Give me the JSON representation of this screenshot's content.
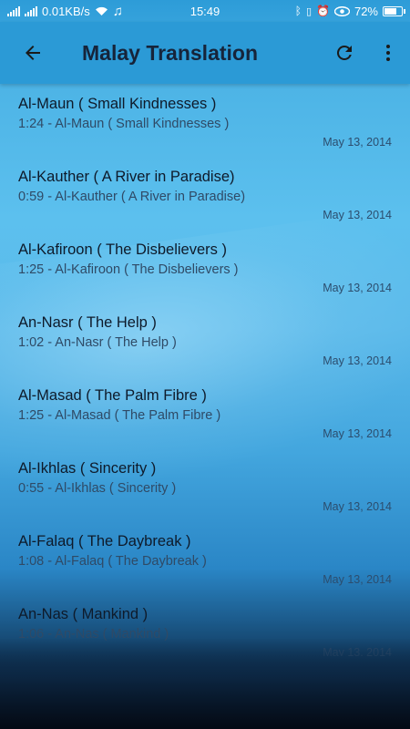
{
  "status_bar": {
    "speed": "0.01KB/s",
    "time": "15:49",
    "battery": "72%",
    "battery_level": 0.72
  },
  "app_bar": {
    "title": "Malay Translation"
  },
  "items": [
    {
      "title": "Al-Maun ( Small Kindnesses )",
      "subtitle": "1:24 - Al-Maun ( Small Kindnesses )",
      "date": "May 13, 2014"
    },
    {
      "title": "Al-Kauther ( A River in Paradise)",
      "subtitle": "0:59 - Al-Kauther ( A River in Paradise)",
      "date": "May 13, 2014"
    },
    {
      "title": "Al-Kafiroon ( The Disbelievers )",
      "subtitle": "1:25 - Al-Kafiroon ( The Disbelievers )",
      "date": "May 13, 2014"
    },
    {
      "title": "An-Nasr ( The Help )",
      "subtitle": "1:02 - An-Nasr ( The Help )",
      "date": "May 13, 2014"
    },
    {
      "title": "Al-Masad ( The Palm Fibre )",
      "subtitle": "1:25 - Al-Masad ( The Palm Fibre )",
      "date": "May 13, 2014"
    },
    {
      "title": "Al-Ikhlas ( Sincerity )",
      "subtitle": "0:55 - Al-Ikhlas ( Sincerity )",
      "date": "May 13, 2014"
    },
    {
      "title": "Al-Falaq ( The Daybreak )",
      "subtitle": "1:08 - Al-Falaq ( The Daybreak )",
      "date": "May 13, 2014"
    },
    {
      "title": "An-Nas ( Mankind )",
      "subtitle": "1:06 - An-Nas ( Mankind )",
      "date": "May 13, 2014"
    }
  ]
}
